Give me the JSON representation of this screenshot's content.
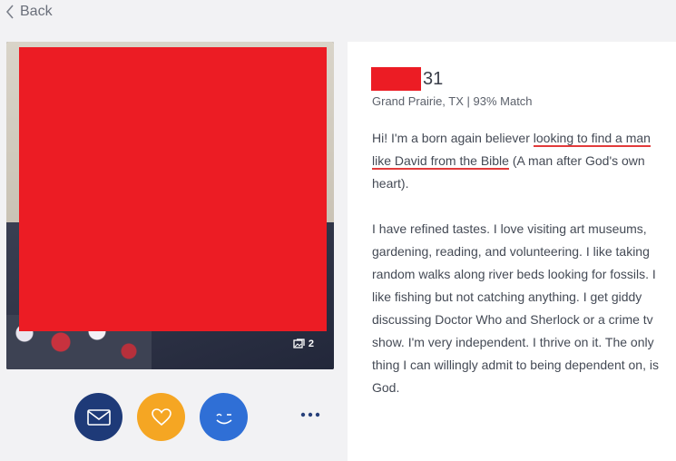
{
  "nav": {
    "back_label": "Back"
  },
  "photo": {
    "photo_count": "2"
  },
  "profile": {
    "age": "31",
    "location_match": "Grand Prairie, TX | 93% Match",
    "bio": {
      "p1_a": "Hi! I'm a born again believer ",
      "p1_highlight": "looking to find a man like David from the Bible",
      "p1_b": " (A man after God's own heart).",
      "p2": "I have refined tastes. I love visiting art museums, gardening, reading, and volunteering. I like taking random walks along river beds looking for fossils. I like fishing but not catching anything. I get giddy discussing Doctor Who and Sherlock or a crime tv show. I'm very independent. I thrive on it. The only thing I can willingly admit to being dependent on, is God."
    }
  },
  "actions": {
    "icons": [
      "envelope-icon",
      "heart-icon",
      "wink-icon",
      "more-dots-icon"
    ]
  },
  "colors": {
    "mail": "#1e3a78",
    "like": "#f5a623",
    "wink": "#2f6fd6",
    "redaction": "#ec1c24",
    "highlight_underline": "#e23b3b"
  }
}
